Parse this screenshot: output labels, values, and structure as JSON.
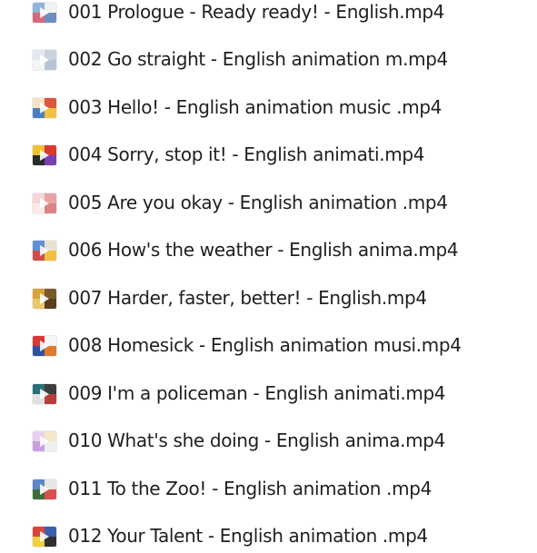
{
  "files": [
    {
      "name": "001 Prologue - Ready ready! - English.mp4",
      "icon": "video-thumbnail-icon",
      "colors": [
        "#8fb4d9",
        "#f2f2f2",
        "#d76a7a",
        "#6b8fbf"
      ]
    },
    {
      "name": "002 Go straight - English animation m.mp4",
      "icon": "video-thumbnail-icon",
      "colors": [
        "#e4e8ee",
        "#c8d3df",
        "#f5f5f5",
        "#b7c4d3"
      ]
    },
    {
      "name": "003 Hello! - English animation music .mp4",
      "icon": "video-thumbnail-icon",
      "colors": [
        "#f4e3c4",
        "#d9573c",
        "#4a7fbf",
        "#f0c040"
      ]
    },
    {
      "name": "004 Sorry, stop it! - English animati.mp4",
      "icon": "video-thumbnail-icon",
      "colors": [
        "#f2c12e",
        "#d9382f",
        "#2a2a2a",
        "#7a3fb0"
      ]
    },
    {
      "name": "005 Are you okay - English animation .mp4",
      "icon": "video-thumbnail-icon",
      "colors": [
        "#f3d6d6",
        "#e8a3a3",
        "#fbeaea",
        "#d98585"
      ]
    },
    {
      "name": "006 How's the weather - English anima.mp4",
      "icon": "video-thumbnail-icon",
      "colors": [
        "#5f8fd6",
        "#e8e0d0",
        "#d24a4a",
        "#f2c040"
      ]
    },
    {
      "name": "007 Harder, faster, better! - English.mp4",
      "icon": "video-thumbnail-icon",
      "colors": [
        "#d6a437",
        "#7a5a2a",
        "#e9c969",
        "#5a3f1f"
      ]
    },
    {
      "name": "008 Homesick - English animation musi.mp4",
      "icon": "video-thumbnail-icon",
      "colors": [
        "#d93636",
        "#f5f5f5",
        "#2f4fa0",
        "#e07a2f"
      ]
    },
    {
      "name": "009 I'm a policeman - English animati.mp4",
      "icon": "video-thumbnail-icon",
      "colors": [
        "#2a6f7a",
        "#3d3d3d",
        "#e0e0e0",
        "#b83d3d"
      ]
    },
    {
      "name": "010 What's she doing - English anima.mp4",
      "icon": "video-thumbnail-icon",
      "colors": [
        "#e8d1f0",
        "#f5e6c8",
        "#c9a0e0",
        "#f0f0f0"
      ]
    },
    {
      "name": "011 To the Zoo! - English animation .mp4",
      "icon": "video-thumbnail-icon",
      "colors": [
        "#5b86c8",
        "#e6e6e6",
        "#3c6e3c",
        "#d94f4f"
      ]
    },
    {
      "name": "012 Your Talent - English animation .mp4",
      "icon": "video-thumbnail-icon",
      "colors": [
        "#d9453a",
        "#3b5fa8",
        "#f2d040",
        "#2f2f2f"
      ]
    }
  ]
}
